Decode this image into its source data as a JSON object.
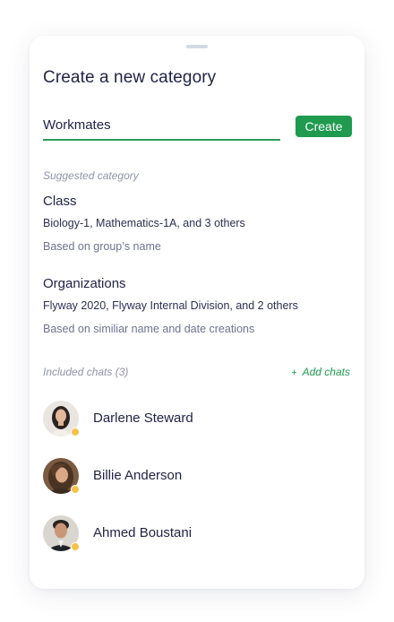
{
  "dialog": {
    "title": "Create a new category",
    "category_name_value": "Workmates",
    "create_label": "Create"
  },
  "suggested": {
    "label": "Suggested category",
    "items": [
      {
        "name": "Class",
        "members": "Biology-1, Mathematics-1A, and 3 others",
        "basis": "Based on group’s name"
      },
      {
        "name": "Organizations",
        "members": "Flyway 2020, Flyway Internal Division, and 2 others",
        "basis": "Based on similiar name and date creations"
      }
    ]
  },
  "included": {
    "label": "Included chats (3)",
    "add_label": "Add chats",
    "add_icon": "plus-icon",
    "chats": [
      {
        "name": "Darlene Steward",
        "status_color": "#f5c24a"
      },
      {
        "name": "Billie Anderson",
        "status_color": "#f5c24a"
      },
      {
        "name": "Ahmed Boustani",
        "status_color": "#f5c24a"
      }
    ]
  },
  "colors": {
    "accent": "#1f9a4f",
    "text_primary": "#202447",
    "text_secondary": "#6e7390",
    "status_away": "#f5c24a"
  }
}
